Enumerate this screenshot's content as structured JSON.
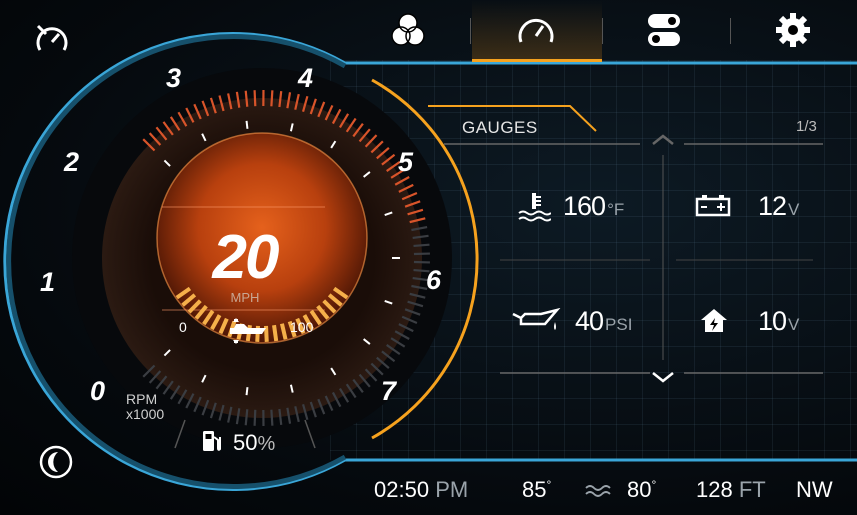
{
  "top_bar": {
    "icons": [
      "cruise-control-icon",
      "modes-icon",
      "gauge-icon",
      "toggles-icon",
      "settings-icon"
    ],
    "selected_tab": "gauge-icon",
    "accent_color": "#f6a21e"
  },
  "speedometer": {
    "speed": "20",
    "speed_unit": "MPH",
    "rpm_ticks": [
      "0",
      "1",
      "2",
      "3",
      "4",
      "5",
      "6",
      "7"
    ],
    "rpm_caption_line1": "RPM",
    "rpm_caption_line2": "x1000",
    "trim_min": "0",
    "trim_max": "100",
    "fuel_value": "50",
    "fuel_unit": "%"
  },
  "gauges_panel": {
    "title": "GAUGES",
    "page": "1/3",
    "items": [
      {
        "icon": "coolant-temp-icon",
        "value": "160",
        "unit": "°F"
      },
      {
        "icon": "battery-icon",
        "value": "12",
        "unit": "V"
      },
      {
        "icon": "oil-pressure-icon",
        "value": "40",
        "unit": "PSI"
      },
      {
        "icon": "house-battery-icon",
        "value": "10",
        "unit": "V"
      }
    ]
  },
  "status_bar": {
    "time": "02:50",
    "ampm": "PM",
    "air_temp": "85",
    "water_temp": "80",
    "degree": "°",
    "depth": "128",
    "depth_unit": "FT",
    "heading": "NW"
  },
  "colors": {
    "blue_frame": "#3aa6d8",
    "orange": "#f6a21e",
    "rpm_red": "#d8542a"
  }
}
